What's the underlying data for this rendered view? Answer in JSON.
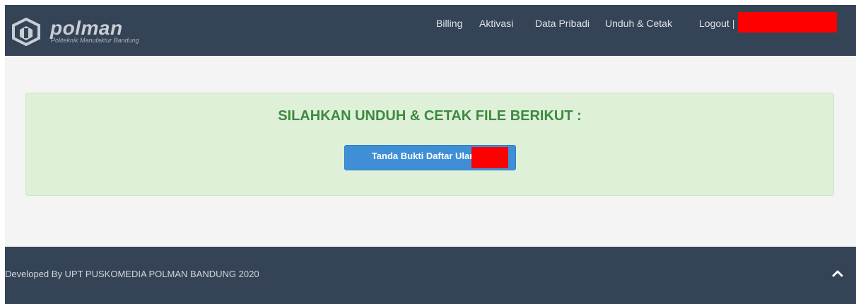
{
  "header": {
    "brand_name": "polman",
    "brand_tagline": "Politeknik Manufaktur Bandung",
    "logo_icon": "hexagon-logo-icon",
    "nav": {
      "billing": "Billing",
      "aktivasi": "Aktivasi",
      "data_pribadi": "Data Pribadi",
      "unduh_cetak": "Unduh & Cetak",
      "logout": "Logout |"
    }
  },
  "main": {
    "alert_title": "SILAHKAN UNDUH & CETAK FILE BERIKUT :",
    "download_button_label": "Tanda Bukti Daftar Ulang"
  },
  "footer": {
    "text": "Developed By UPT PUSKOMEDIA POLMAN BANDUNG 2020",
    "scroll_icon": "chevron-up-icon"
  },
  "colors": {
    "navbar_bg": "#344356",
    "alert_bg": "#dff0d8",
    "alert_text": "#3c8a3f",
    "button_bg": "#3f8fd6",
    "redaction": "#ff0000"
  }
}
